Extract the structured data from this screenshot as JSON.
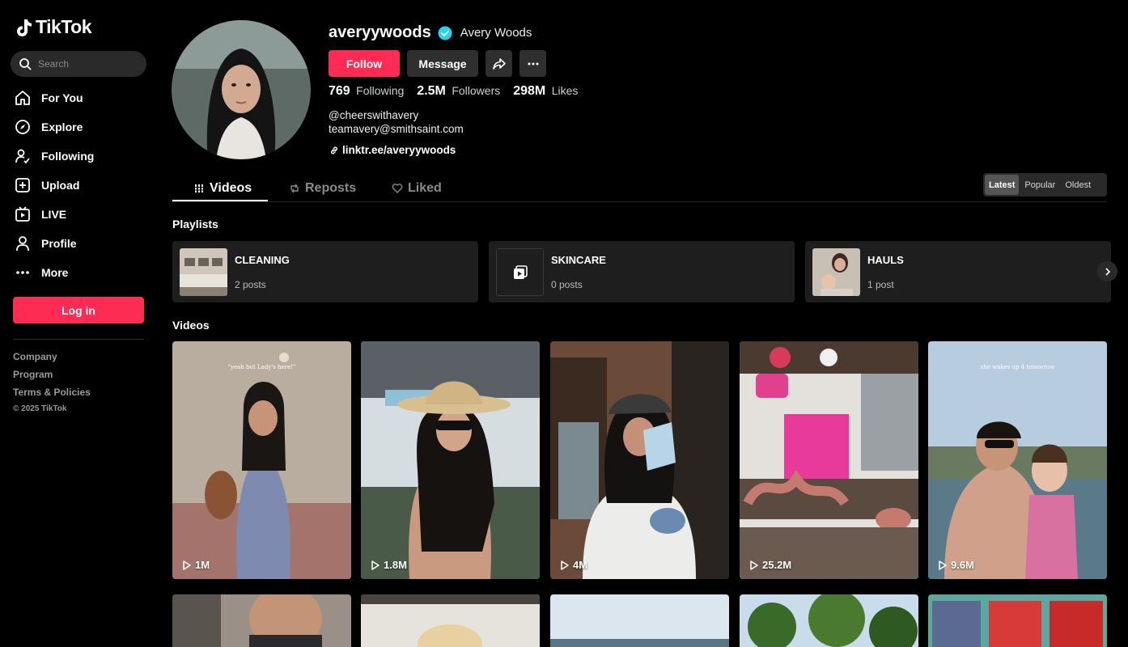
{
  "brand": {
    "name": "TikTok"
  },
  "search": {
    "placeholder": "Search"
  },
  "nav": {
    "items": [
      {
        "label": "For You",
        "icon": "home-icon"
      },
      {
        "label": "Explore",
        "icon": "compass-icon"
      },
      {
        "label": "Following",
        "icon": "following-icon"
      },
      {
        "label": "Upload",
        "icon": "upload-icon"
      },
      {
        "label": "LIVE",
        "icon": "live-icon"
      },
      {
        "label": "Profile",
        "icon": "profile-icon"
      },
      {
        "label": "More",
        "icon": "more-icon"
      }
    ]
  },
  "login": {
    "label": "Log in"
  },
  "footer": {
    "links": [
      "Company",
      "Program",
      "Terms & Policies"
    ],
    "copyright": "© 2025 TikTok"
  },
  "profile": {
    "username": "averyywoods",
    "display_name": "Avery Woods",
    "verified": true,
    "follow_label": "Follow",
    "message_label": "Message",
    "stats": {
      "following": {
        "value": "769",
        "label": "Following"
      },
      "followers": {
        "value": "2.5M",
        "label": "Followers"
      },
      "likes": {
        "value": "298M",
        "label": "Likes"
      }
    },
    "bio_line1": "@cheerswithavery",
    "bio_line2": "teamavery@smithsaint.com",
    "link": "linktr.ee/averyywoods"
  },
  "tabs": {
    "videos": "Videos",
    "reposts": "Reposts",
    "liked": "Liked"
  },
  "sort": {
    "options": [
      "Latest",
      "Popular",
      "Oldest"
    ],
    "selected": "Latest"
  },
  "sections": {
    "playlists": "Playlists",
    "videos": "Videos"
  },
  "playlists": [
    {
      "name": "CLEANING",
      "count": "2 posts"
    },
    {
      "name": "SKINCARE",
      "count": "0 posts"
    },
    {
      "name": "HAULS",
      "count": "1 post"
    }
  ],
  "videos": [
    {
      "views": "1M",
      "caption": "\"yeah but Lady's here!\""
    },
    {
      "views": "1.8M",
      "caption": ""
    },
    {
      "views": "4M",
      "caption": ""
    },
    {
      "views": "25.2M",
      "caption": ""
    },
    {
      "views": "9.6M",
      "caption": "she wakes up 4 tomorrow"
    }
  ],
  "colors": {
    "accent": "#fe2c55",
    "verified": "#20d5ec"
  }
}
